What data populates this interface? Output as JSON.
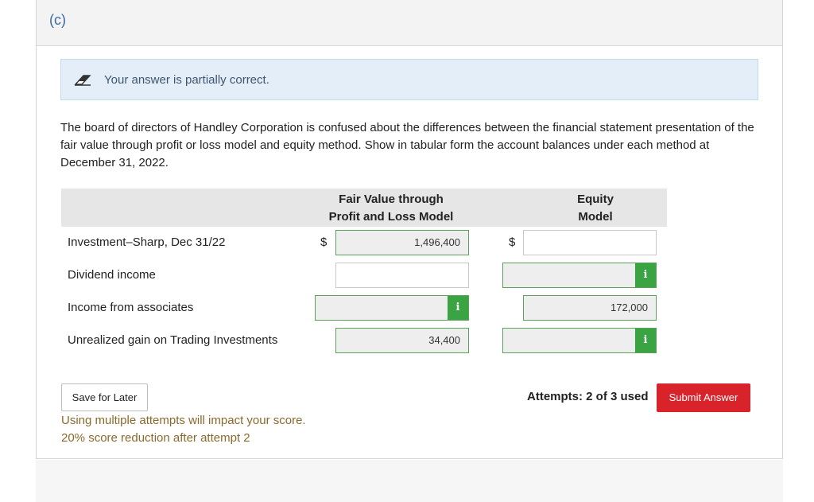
{
  "part_label": "(c)",
  "feedback": {
    "text": "Your answer is partially correct.",
    "icon": "pencil-eraser-icon"
  },
  "question": "The board of directors of Handley Corporation is confused about the differences between the financial statement presentation of the fair value through profit or loss model and equity method. Show in tabular form the account balances under each method at December 31, 2022.",
  "table": {
    "columns": [
      {
        "line1": "Fair Value through",
        "line2": "Profit and Loss Model"
      },
      {
        "line1": "Equity",
        "line2": "Model"
      }
    ],
    "currency_symbol": "$",
    "rows": [
      {
        "label": "Investment–Sharp, Dec 31/22",
        "fair_value": "1,496,400",
        "equity": ""
      },
      {
        "label": "Dividend income",
        "fair_value": "",
        "equity": ""
      },
      {
        "label": "Income from associates",
        "fair_value": "",
        "equity": "172,000"
      },
      {
        "label": "Unrealized gain on Trading Investments",
        "fair_value": "34,400",
        "equity": ""
      }
    ],
    "info_icon": "i"
  },
  "footer": {
    "save_label": "Save for Later",
    "warning_line1": "Using multiple attempts will impact your score.",
    "warning_line2": "20% score reduction after attempt 2",
    "attempts": "Attempts: 2 of 3 used",
    "submit_label": "Submit Answer"
  },
  "colors": {
    "accent_green": "#3aa443",
    "submit_red": "#d9232b",
    "feedback_bg": "#e3eef8"
  }
}
